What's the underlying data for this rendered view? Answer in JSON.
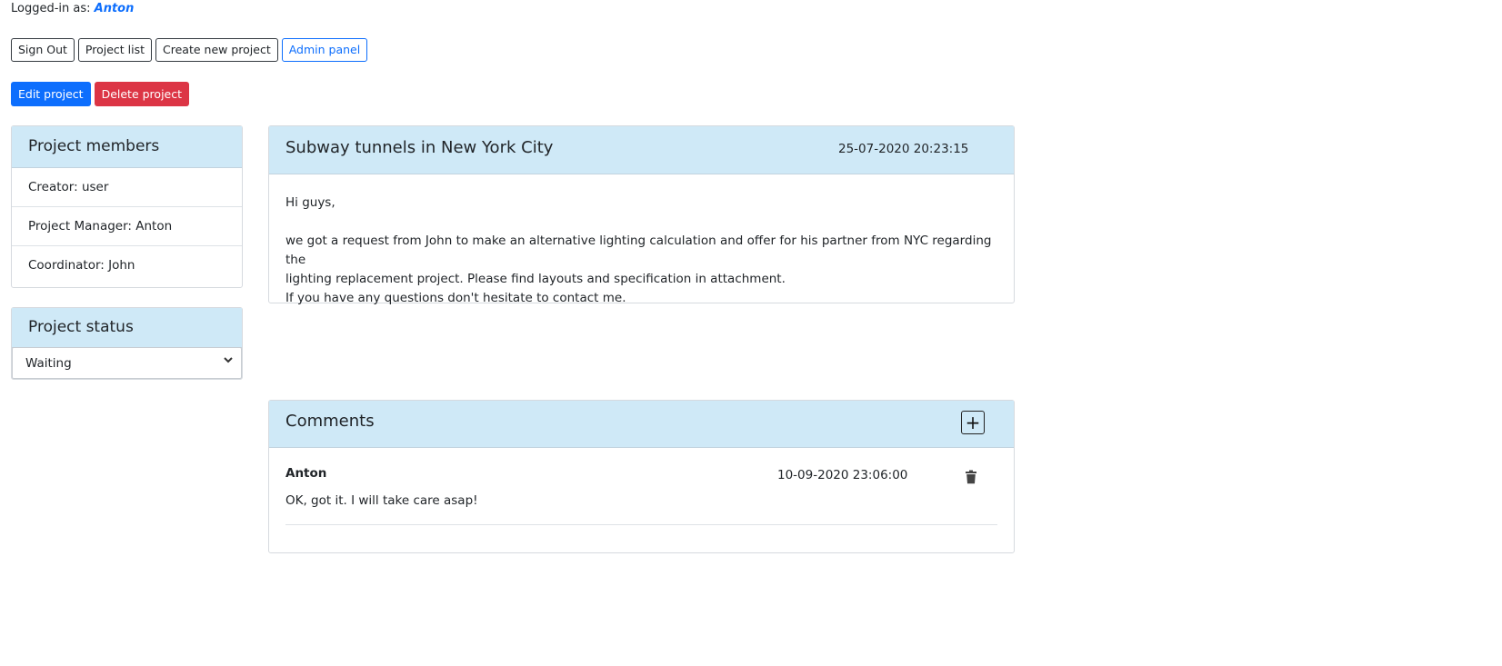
{
  "header": {
    "logged_label": "Logged-in as:",
    "username": "Anton"
  },
  "nav": {
    "sign_out": "Sign Out",
    "project_list": "Project list",
    "create_project": "Create new project",
    "admin_panel": "Admin panel"
  },
  "actions": {
    "edit": "Edit project",
    "delete": "Delete project"
  },
  "members": {
    "title": "Project members",
    "items": [
      {
        "label": "Creator: user"
      },
      {
        "label": "Project Manager: Anton"
      },
      {
        "label": "Coordinator: John"
      }
    ]
  },
  "status": {
    "title": "Project status",
    "selected": "Waiting"
  },
  "project": {
    "title": "Subway tunnels in New York City",
    "date": "25-07-2020 20:23:15",
    "greeting": "Hi guys,",
    "line1": "we got a request from John to make an alternative lighting calculation and offer for his partner from NYC regarding the",
    "line2": "lighting replacement project. Please find layouts and specification in attachment.",
    "line3": "If you have any questions don't hesitate to contact me."
  },
  "comments": {
    "title": "Comments",
    "add_symbol": "+",
    "items": [
      {
        "author": "Anton",
        "date": "10-09-2020 23:06:00",
        "text": "OK, got it. I will take care asap!"
      }
    ]
  },
  "colors": {
    "primary": "#0d6efd",
    "danger": "#dc3545",
    "header_bg": "#cfe9f7"
  }
}
